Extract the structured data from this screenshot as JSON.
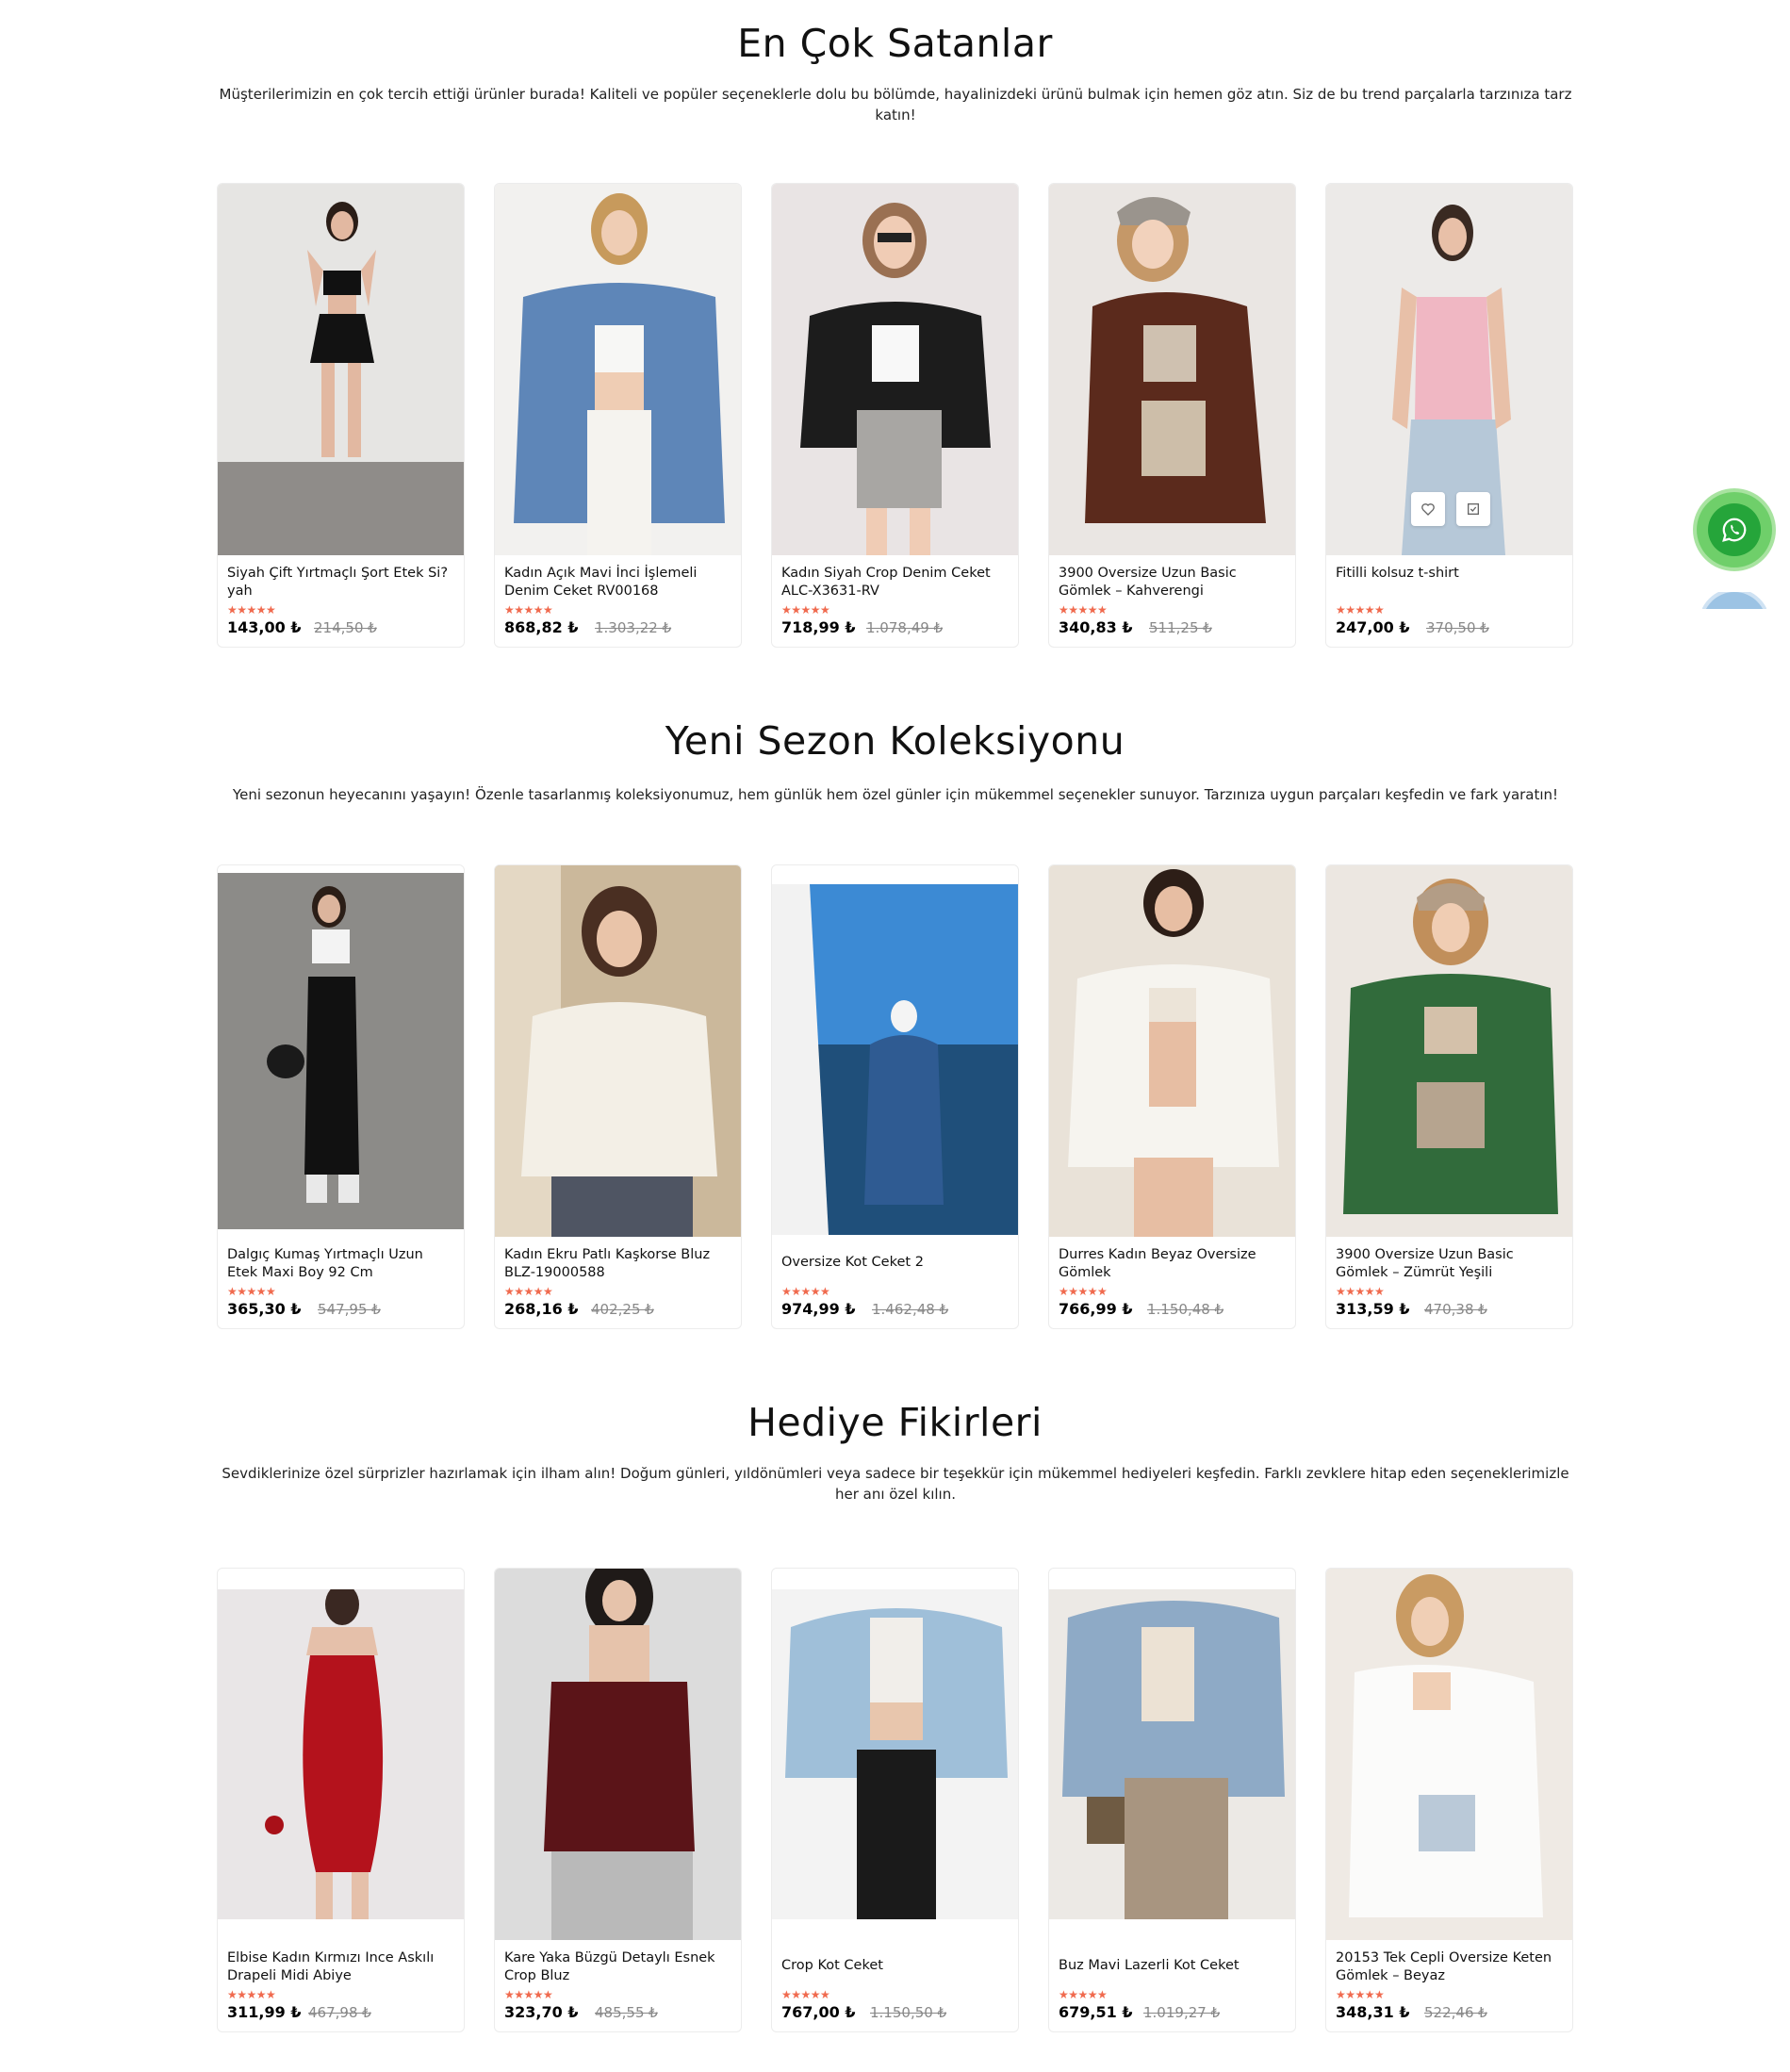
{
  "sections": [
    {
      "title": "En Çok Satanlar",
      "description": "Müşterilerimizin en çok tercih ettiği ürünler burada! Kaliteli ve popüler seçeneklerle dolu bu bölümde, hayalinizdeki ürünü bulmak için hemen göz atın. Siz de bu trend parçalarla tarzınıza tarz katın!",
      "products": [
        {
          "name": "Siyah Çift Yırtmaçlı Şort Etek Si?yah",
          "rating": "★★★★★",
          "price": "143,00 ₺",
          "old_price": "214,50 ₺"
        },
        {
          "name": "Kadın Açık Mavi İnci İşlemeli Denim Ceket RV00168",
          "rating": "★★★★★",
          "price": "868,82 ₺",
          "old_price": "1.303,22 ₺"
        },
        {
          "name": "Kadın Siyah Crop Denim Ceket ALC-X3631-RV",
          "rating": "★★★★★",
          "price": "718,99 ₺",
          "old_price": "1.078,49 ₺"
        },
        {
          "name": "3900 Oversize Uzun Basic Gömlek – Kahverengi",
          "rating": "★★★★★",
          "price": "340,83 ₺",
          "old_price": "511,25 ₺"
        },
        {
          "name": "Fitilli kolsuz t-shirt",
          "rating": "★★★★★",
          "price": "247,00 ₺",
          "old_price": "370,50 ₺"
        }
      ]
    },
    {
      "title": "Yeni Sezon Koleksiyonu",
      "description": "Yeni sezonun heyecanını yaşayın! Özenle tasarlanmış koleksiyonumuz, hem günlük hem özel günler için mükemmel seçenekler sunuyor. Tarzınıza uygun parçaları keşfedin ve fark yaratın!",
      "products": [
        {
          "name": "Dalgıç Kumaş Yırtmaçlı Uzun Etek Maxi Boy 92 Cm",
          "rating": "★★★★★",
          "price": "365,30 ₺",
          "old_price": "547,95 ₺"
        },
        {
          "name": "Kadın Ekru Patlı Kaşkorse Bluz BLZ-19000588",
          "rating": "★★★★★",
          "price": "268,16 ₺",
          "old_price": "402,25 ₺"
        },
        {
          "name": "Oversize Kot Ceket 2",
          "rating": "★★★★★",
          "price": "974,99 ₺",
          "old_price": "1.462,48 ₺"
        },
        {
          "name": "Durres Kadın Beyaz Oversize Gömlek",
          "rating": "★★★★★",
          "price": "766,99 ₺",
          "old_price": "1.150,48 ₺"
        },
        {
          "name": "3900 Oversize Uzun Basic Gömlek – Zümrüt Yeşili",
          "rating": "★★★★★",
          "price": "313,59 ₺",
          "old_price": "470,38 ₺"
        }
      ]
    },
    {
      "title": "Hediye Fikirleri",
      "description": "Sevdiklerinize özel sürprizler hazırlamak için ilham alın! Doğum günleri, yıldönümleri veya sadece bir teşekkür için mükemmel hediyeleri keşfedin. Farklı zevklere hitap eden seçeneklerimizle her anı özel kılın.",
      "products": [
        {
          "name": "Elbise Kadın Kırmızı Ince Askılı Drapeli Midi Abiye",
          "rating": "★★★★★",
          "price": "311,99 ₺",
          "old_price": "467,98 ₺"
        },
        {
          "name": "Kare Yaka Büzgü Detaylı Esnek Crop Bluz",
          "rating": "★★★★★",
          "price": "323,70 ₺",
          "old_price": "485,55 ₺"
        },
        {
          "name": "Crop Kot Ceket",
          "rating": "★★★★★",
          "price": "767,00 ₺",
          "old_price": "1.150,50 ₺"
        },
        {
          "name": "Buz Mavi Lazerli Kot Ceket",
          "rating": "★★★★★",
          "price": "679,51 ₺",
          "old_price": "1.019,27 ₺"
        },
        {
          "name": "20153 Tek Cepli Oversize Keten Gömlek – Beyaz",
          "rating": "★★★★★",
          "price": "348,31 ₺",
          "old_price": "522,46 ₺"
        }
      ]
    }
  ],
  "colors": {
    "star": "#f06a4e",
    "whatsapp": "#25a53a"
  },
  "icons": {
    "wishlist": "heart-icon",
    "quick_view": "quick-view-icon",
    "whatsapp": "whatsapp-icon"
  }
}
